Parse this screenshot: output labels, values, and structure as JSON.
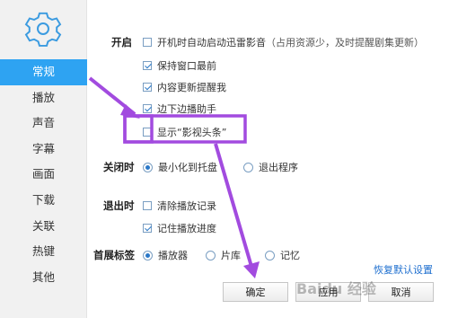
{
  "sidebar": {
    "icon": "gear-icon",
    "items": [
      {
        "label": "常规",
        "active": true
      },
      {
        "label": "播放",
        "active": false
      },
      {
        "label": "声音",
        "active": false
      },
      {
        "label": "字幕",
        "active": false
      },
      {
        "label": "画面",
        "active": false
      },
      {
        "label": "下载",
        "active": false
      },
      {
        "label": "关联",
        "active": false
      },
      {
        "label": "热键",
        "active": false
      },
      {
        "label": "其他",
        "active": false
      }
    ]
  },
  "startup": {
    "label": "开启",
    "options": [
      {
        "label": "开机时自动启动迅雷影音",
        "hint": "（占用资源少，及时提醒剧集更新）",
        "checked": false
      },
      {
        "label": "保持窗口最前",
        "checked": true
      },
      {
        "label": "内容更新提醒我",
        "checked": true
      },
      {
        "label": "边下边播助手",
        "checked": true
      },
      {
        "label": "显示“影视头条”",
        "checked": false
      }
    ]
  },
  "on_close": {
    "label": "关闭时",
    "options": [
      {
        "label": "最小化到托盘",
        "selected": true
      },
      {
        "label": "退出程序",
        "selected": false
      }
    ]
  },
  "on_exit": {
    "label": "退出时",
    "options": [
      {
        "label": "清除播放记录",
        "checked": false
      },
      {
        "label": "记住播放进度",
        "checked": true
      }
    ]
  },
  "home_tab": {
    "label": "首展标签",
    "options": [
      {
        "label": "播放器",
        "selected": true
      },
      {
        "label": "片库",
        "selected": false
      },
      {
        "label": "记忆",
        "selected": false
      }
    ]
  },
  "restore_defaults": "恢复默认设置",
  "buttons": {
    "ok": "确定",
    "apply": "应用",
    "cancel": "取消"
  },
  "watermark": "Baidu 经验",
  "colors": {
    "active": "#2ea3f2",
    "annotation": "#a24bdf",
    "link": "#1d6ecf"
  }
}
